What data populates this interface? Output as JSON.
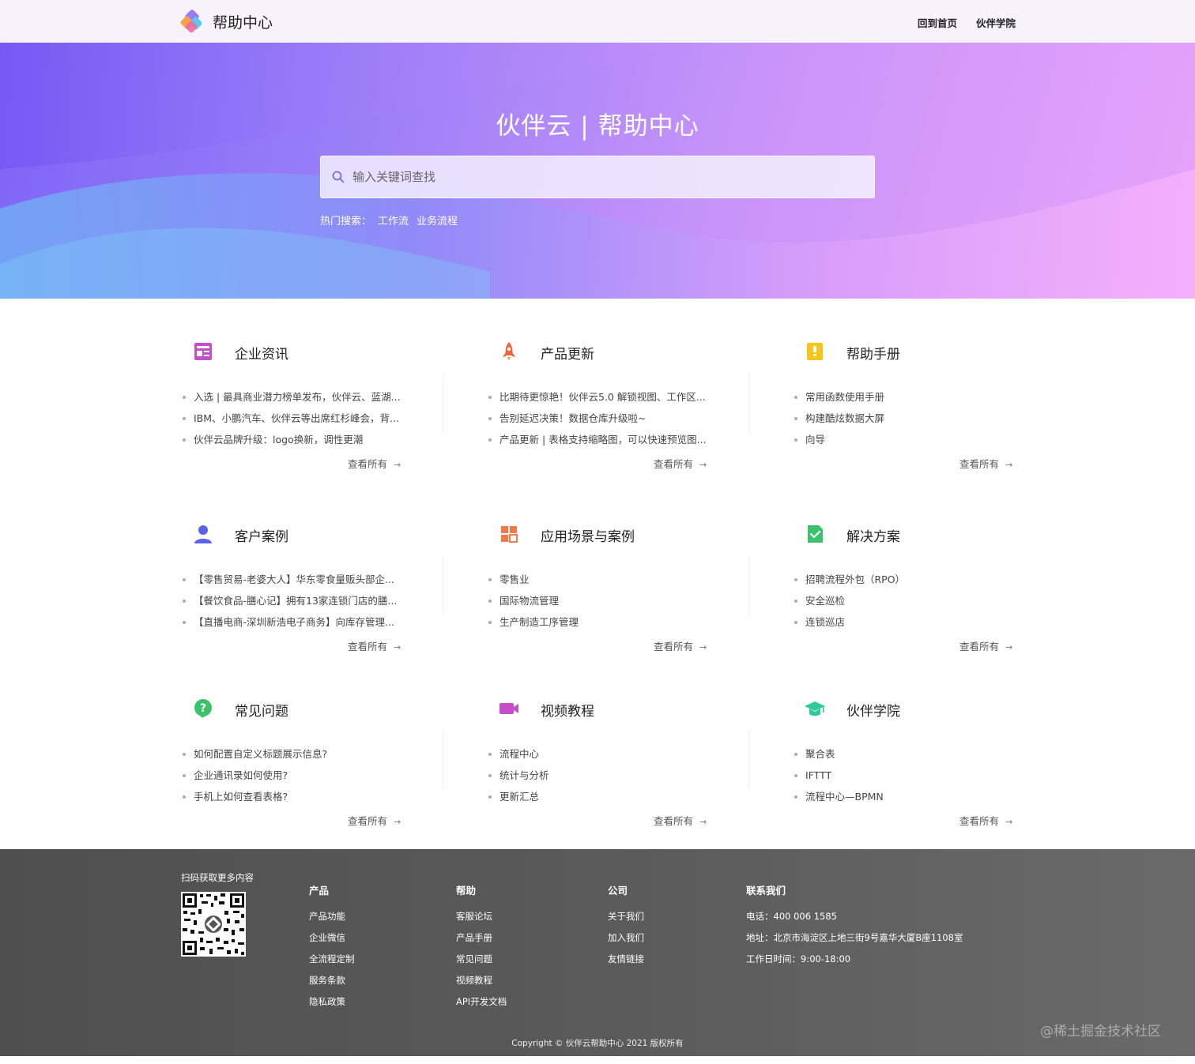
{
  "header": {
    "brand": "帮助中心",
    "nav": [
      {
        "label": "回到首页"
      },
      {
        "label": "伙伴学院"
      }
    ]
  },
  "hero": {
    "title": "伙伴云 | 帮助中心",
    "search_placeholder": "输入关键词查找",
    "hot_label": "热门搜索：",
    "hot_terms": [
      "工作流",
      "业务流程"
    ]
  },
  "sections": [
    {
      "title": "企业资讯",
      "icon": "news-icon",
      "color": "#c450c9",
      "items": [
        "入选 | 最具商业潜力榜单发布，伙伴云、蓝湖...",
        "IBM、小鹏汽车、伙伴云等出席红杉峰会，背...",
        "伙伴云品牌升级：logo换新，调性更潮"
      ],
      "more": "查看所有"
    },
    {
      "title": "产品更新",
      "icon": "rocket-icon",
      "color": "#f0643c",
      "items": [
        "比期待更惊艳！伙伴云5.0 解锁视图、工作区...",
        "告别延迟决策！数据仓库升级啦~",
        "产品更新 | 表格支持缩略图，可以快速预览图..."
      ],
      "more": "查看所有"
    },
    {
      "title": "帮助手册",
      "icon": "handbook-icon",
      "color": "#f5c518",
      "items": [
        "常用函数使用手册",
        "构建酷炫数据大屏",
        "向导"
      ],
      "more": "查看所有"
    },
    {
      "title": "客户案例",
      "icon": "user-icon",
      "color": "#5a63e8",
      "items": [
        "【零售贸易-老婆大人】华东零食量贩头部企...",
        "【餐饮食品-膳心记】拥有13家连锁门店的膳...",
        "【直播电商-深圳新浩电子商务】向库存管理..."
      ],
      "more": "查看所有"
    },
    {
      "title": "应用场景与案例",
      "icon": "grid-icon",
      "color": "#f07a4a",
      "items": [
        "零售业",
        "国际物流管理",
        "生产制造工序管理"
      ],
      "more": "查看所有"
    },
    {
      "title": "解决方案",
      "icon": "document-check-icon",
      "color": "#3cc26a",
      "items": [
        "招聘流程外包（RPO）",
        "安全巡检",
        "连锁巡店"
      ],
      "more": "查看所有"
    },
    {
      "title": "常见问题",
      "icon": "question-icon",
      "color": "#3cc26a",
      "items": [
        "如何配置自定义标题展示信息?",
        "企业通讯录如何使用?",
        "手机上如何查看表格?"
      ],
      "more": "查看所有"
    },
    {
      "title": "视频教程",
      "icon": "video-camera-icon",
      "color": "#c450c9",
      "items": [
        "流程中心",
        "统计与分析",
        "更新汇总"
      ],
      "more": "查看所有"
    },
    {
      "title": "伙伴学院",
      "icon": "graduation-cap-icon",
      "color": "#2fc89a",
      "items": [
        "聚合表",
        "IFTTT",
        "流程中心—BPMN"
      ],
      "more": "查看所有"
    }
  ],
  "footer": {
    "scan_label": "扫码获取更多内容",
    "columns": [
      {
        "title": "产品",
        "items": [
          "产品功能",
          "企业微信",
          "全流程定制",
          "服务条款",
          "隐私政策"
        ]
      },
      {
        "title": "帮助",
        "items": [
          "客服论坛",
          "产品手册",
          "常见问题",
          "视频教程",
          "API开发文档"
        ]
      },
      {
        "title": "公司",
        "items": [
          "关于我们",
          "加入我们",
          "友情链接"
        ]
      }
    ],
    "contact": {
      "title": "联系我们",
      "lines": [
        "电话：400 006 1585",
        "地址：北京市海淀区上地三街9号嘉华大厦B座1108室",
        "工作日时间：9:00-18:00"
      ]
    },
    "copyright": "Copyright © 伙伴云帮助中心 2021 版权所有",
    "watermark": "@稀土掘金技术社区"
  }
}
